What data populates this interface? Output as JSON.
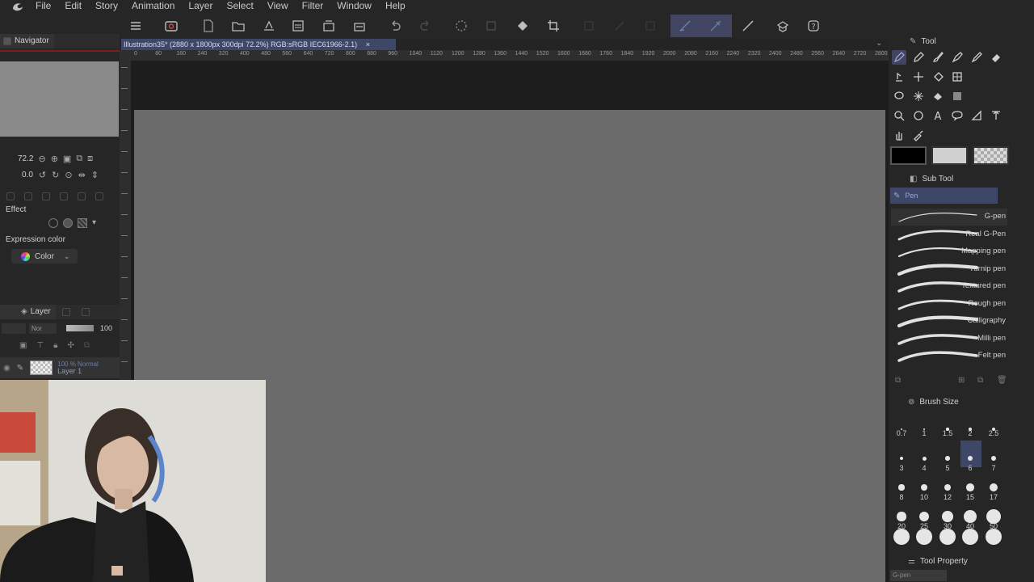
{
  "menu": {
    "items": [
      "File",
      "Edit",
      "Story",
      "Animation",
      "Layer",
      "Select",
      "View",
      "Filter",
      "Window",
      "Help"
    ]
  },
  "document": {
    "tab_title": "Illustration35* (2880 x 1800px 300dpi 72.2%) RGB:sRGB IEC61966-2.1)",
    "close_glyph": "×"
  },
  "ruler": {
    "ticks": [
      "0",
      "80",
      "160",
      "240",
      "320",
      "400",
      "480",
      "560",
      "640",
      "720",
      "800",
      "880",
      "960",
      "1040",
      "1120",
      "1200",
      "1280",
      "1360",
      "1440",
      "1520",
      "1600",
      "1680",
      "1760",
      "1840",
      "1920",
      "2000",
      "2080",
      "2160",
      "2240",
      "2320",
      "2400",
      "2480",
      "2560",
      "2640",
      "2720",
      "2800"
    ]
  },
  "navigator": {
    "title": "Navigator",
    "zoom_value": "72.2",
    "rotation_value": "0.0"
  },
  "effect_panel": {
    "effect_label": "Effect",
    "expression_color_label": "Expression color",
    "color_dropdown_value": "Color"
  },
  "layer_panel": {
    "title": "Layer",
    "blend_mode": "Nor",
    "opacity": "100",
    "layer_opacity_text": "100 %",
    "layer_mode_text": "Normal",
    "layer_name": "Layer 1"
  },
  "tool_panel": {
    "title": "Tool",
    "main_color": "#000000",
    "sub_color": "#d0d0d0"
  },
  "sub_tool_panel": {
    "title": "Sub Tool",
    "group_label": "Pen",
    "brushes": [
      "G-pen",
      "Real G-Pen",
      "Mapping pen",
      "Turnip pen",
      "Textured pen",
      "Rough pen",
      "Calligraphy",
      "Milli pen",
      "Felt pen"
    ],
    "selected_brush": "G-pen"
  },
  "brush_size_panel": {
    "title": "Brush Size",
    "rows": [
      [
        "0.7",
        "1",
        "1.5",
        "2",
        "2.5"
      ],
      [
        "3",
        "4",
        "5",
        "6",
        "7"
      ],
      [
        "8",
        "10",
        "12",
        "15",
        "17"
      ],
      [
        "20",
        "25",
        "30",
        "40",
        "50"
      ]
    ],
    "selected_size": "6"
  },
  "tool_property_panel": {
    "title": "Tool Property",
    "tool_name": "G-pen"
  },
  "colors": {
    "accent": "#414562",
    "canvas": "#6b6b6b",
    "panel": "#262626"
  }
}
